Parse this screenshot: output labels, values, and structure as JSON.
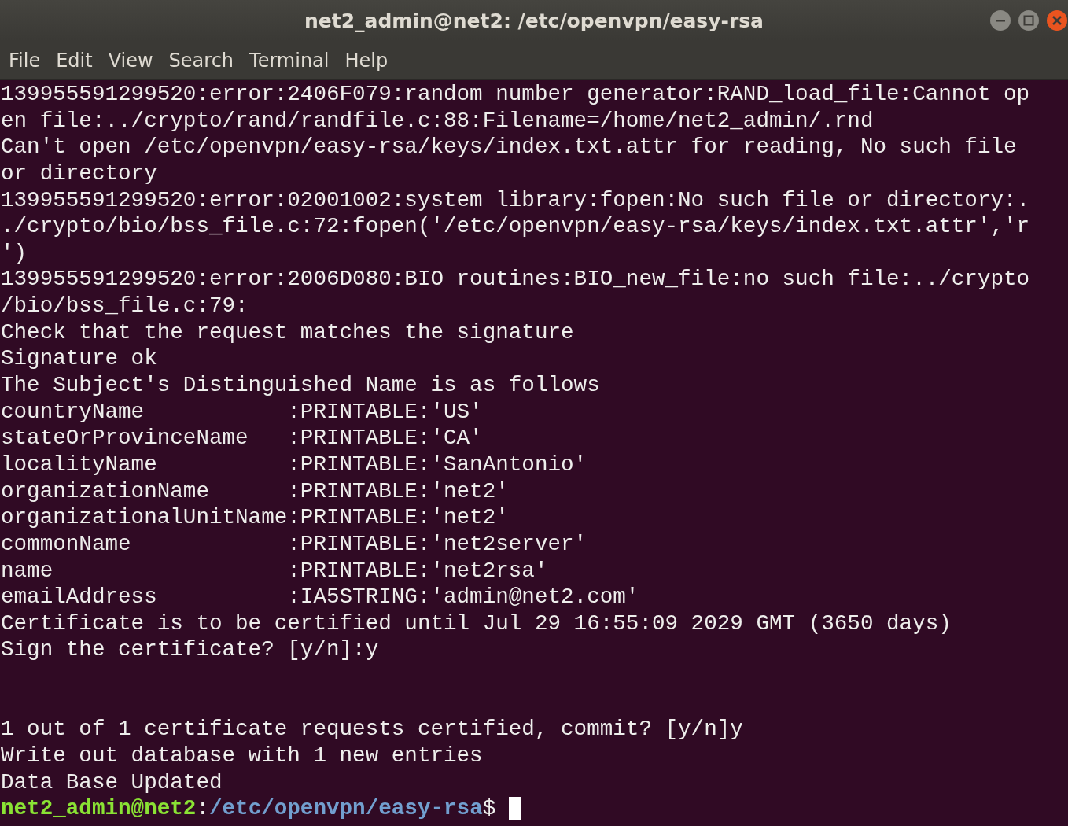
{
  "window": {
    "title": "net2_admin@net2: /etc/openvpn/easy-rsa"
  },
  "menu": [
    "File",
    "Edit",
    "View",
    "Search",
    "Terminal",
    "Help"
  ],
  "lines": [
    {
      "kind": "output",
      "text": "139955591299520:error:2406F079:random number generator:RAND_load_file:Cannot op"
    },
    {
      "kind": "output",
      "text": "en file:../crypto/rand/randfile.c:88:Filename=/home/net2_admin/.rnd"
    },
    {
      "kind": "output",
      "text": "Can't open /etc/openvpn/easy-rsa/keys/index.txt.attr for reading, No such file"
    },
    {
      "kind": "output",
      "text": "or directory"
    },
    {
      "kind": "output",
      "text": "139955591299520:error:02001002:system library:fopen:No such file or directory:."
    },
    {
      "kind": "output",
      "text": "./crypto/bio/bss_file.c:72:fopen('/etc/openvpn/easy-rsa/keys/index.txt.attr','r"
    },
    {
      "kind": "output",
      "text": "')"
    },
    {
      "kind": "output",
      "text": "139955591299520:error:2006D080:BIO routines:BIO_new_file:no such file:../crypto"
    },
    {
      "kind": "output",
      "text": "/bio/bss_file.c:79:"
    },
    {
      "kind": "output",
      "text": "Check that the request matches the signature"
    },
    {
      "kind": "output",
      "text": "Signature ok"
    },
    {
      "kind": "output",
      "text": "The Subject's Distinguished Name is as follows"
    },
    {
      "kind": "output",
      "text": "countryName           :PRINTABLE:'US'"
    },
    {
      "kind": "output",
      "text": "stateOrProvinceName   :PRINTABLE:'CA'"
    },
    {
      "kind": "output",
      "text": "localityName          :PRINTABLE:'SanAntonio'"
    },
    {
      "kind": "output",
      "text": "organizationName      :PRINTABLE:'net2'"
    },
    {
      "kind": "output",
      "text": "organizationalUnitName:PRINTABLE:'net2'"
    },
    {
      "kind": "output",
      "text": "commonName            :PRINTABLE:'net2server'"
    },
    {
      "kind": "output",
      "text": "name                  :PRINTABLE:'net2rsa'"
    },
    {
      "kind": "output",
      "text": "emailAddress          :IA5STRING:'admin@net2.com'"
    },
    {
      "kind": "output",
      "text": "Certificate is to be certified until Jul 29 16:55:09 2029 GMT (3650 days)"
    },
    {
      "kind": "output",
      "text": "Sign the certificate? [y/n]:y"
    },
    {
      "kind": "blank"
    },
    {
      "kind": "blank"
    },
    {
      "kind": "output",
      "text": "1 out of 1 certificate requests certified, commit? [y/n]y"
    },
    {
      "kind": "output",
      "text": "Write out database with 1 new entries"
    },
    {
      "kind": "output",
      "text": "Data Base Updated"
    },
    {
      "kind": "prompt",
      "user": "net2_admin@net2",
      "separator": ":",
      "path": "/etc/openvpn/easy-rsa",
      "symbol": "$"
    }
  ]
}
